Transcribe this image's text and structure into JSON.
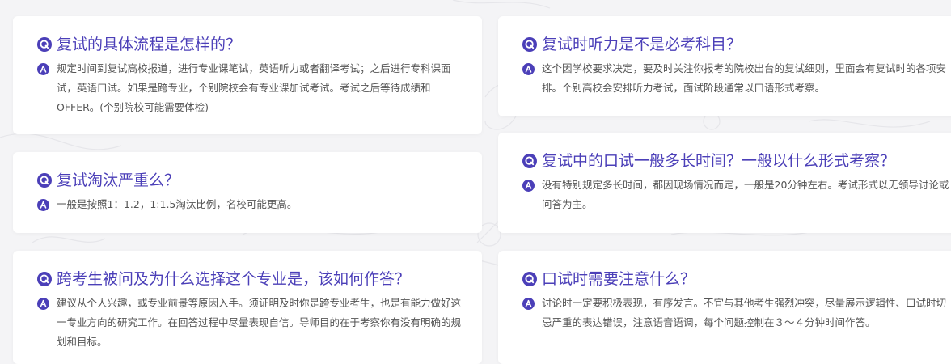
{
  "faq": {
    "items": [
      {
        "question": "复试的具体流程是怎样的？",
        "answer": "规定时间到复试高校报道，进行专业课笔试，英语听力或者翻译考试；之后进行专科课面试，英语口试。如果是跨专业，个别院校会有专业课加试考试。考试之后等待成绩和OFFER。(个别院校可能需要体检)"
      },
      {
        "question": "复试淘汰严重么？",
        "answer": "一般是按照1：1.2，1:1.5淘汰比例，名校可能更高。"
      },
      {
        "question": "跨考生被问及为什么选择这个专业是，该如何作答？",
        "answer": "建议从个人兴趣，或专业前景等原因入手。须证明及时你是跨专业考生，也是有能力做好这一专业方向的研究工作。在回答过程中尽量表现自信。导师目的在于考察你有没有明确的规划和目标。"
      },
      {
        "question": "复试时听力是不是必考科目？",
        "answer": "这个因学校要求决定，要及时关注你报考的院校出台的复试细则，里面会有复试时的各项安排。个别高校会安排听力考试，面试阶段通常以口语形式考察。"
      },
      {
        "question": "复试中的口试一般多长时间？一般以什么形式考察？",
        "answer": "没有特别规定多长时间，都因现场情况而定，一般是20分钟左右。考试形式以无领导讨论或问答为主。"
      },
      {
        "question": "口试时需要注意什么？",
        "answer": "讨论时一定要积极表现，有序发言。不宜与其他考生强烈冲突，尽量展示逻辑性、口试时切忌严重的表达错误，注意语音语调，每个问题控制在３～４分钟时间作答。"
      }
    ]
  },
  "colors": {
    "accent": "#4b3fb8",
    "answer_text": "#555555",
    "card_bg": "#ffffff",
    "page_bg": "#f4f4f6"
  },
  "icons": {
    "question": "q-badge-icon",
    "answer": "a-badge-icon"
  }
}
